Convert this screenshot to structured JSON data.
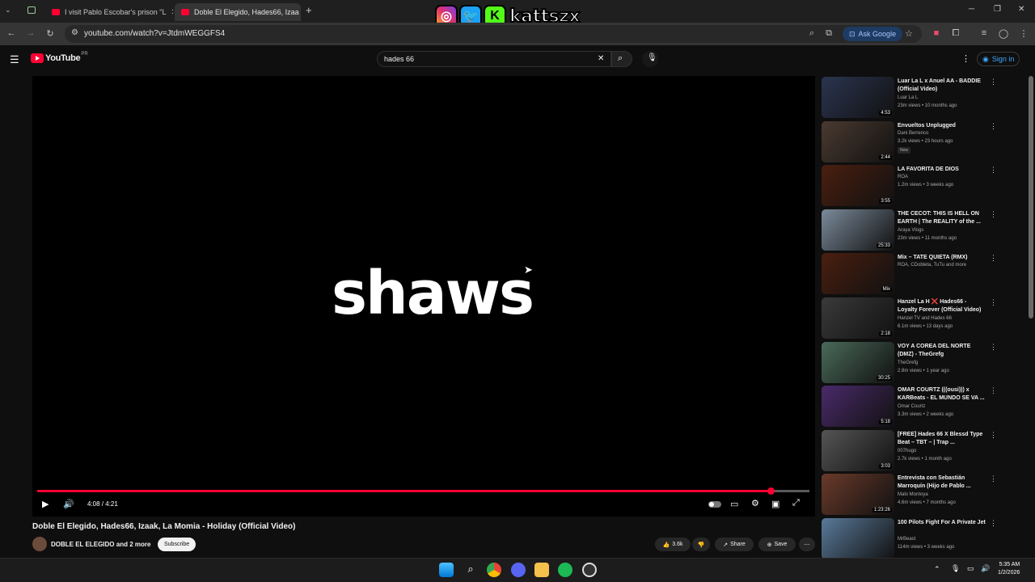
{
  "browser": {
    "tabs": [
      {
        "label": "I visit Pablo Escobar's prison \"L"
      },
      {
        "label": "Doble El Elegido, Hades66, Izaa"
      }
    ],
    "url": "youtube.com/watch?v=JtdmWEGGFS4",
    "ask_google": "Ask Google"
  },
  "overlay": {
    "handle": "kattszx"
  },
  "header": {
    "logo_text": "YouTube",
    "country": "PR",
    "search_value": "hades 66",
    "sign_in": "Sign in"
  },
  "player": {
    "center_text": "shaws",
    "time": "4:08 / 4:21",
    "progress": 0.95
  },
  "video": {
    "title": "Doble El Elegido, Hades66, Izaak, La Momia - Holiday (Official Video)",
    "channel": "DOBLE EL ELEGIDO and 2 more",
    "subscribe": "Subscribe",
    "likes": "3.6k",
    "share": "Share",
    "save": "Save"
  },
  "recommendations": [
    {
      "title": "Luar La L x Anuel AA - BADDIE (Official Video)",
      "channel": "Luar La L",
      "meta": "23m views • 10 months ago",
      "duration": "4:53",
      "color": "#2b3550"
    },
    {
      "title": "Envueltos Unplugged",
      "channel": "Dani Berrenco",
      "meta": "3.2k views • 23 hours ago",
      "duration": "2:44",
      "badge": "New",
      "color": "#4a3a30"
    },
    {
      "title": "LA FAVORITA DE DIOS",
      "channel": "ROA",
      "meta": "1.2m views • 3 weeks ago",
      "duration": "3:55",
      "color": "#4a1f10"
    },
    {
      "title": "THE CECOT: THIS IS HELL ON EARTH | The REALITY of the ...",
      "channel": "Araya Vlogs",
      "meta": "23m views • 11 months ago",
      "duration": "25:33",
      "color": "#7a8a9a"
    },
    {
      "title": "Mix – TATE QUIETA (RMX)",
      "channel": "ROA, CDobleta, TuTu and more",
      "meta": "",
      "duration": "Mix",
      "color": "#4a1f10"
    },
    {
      "title": "Hanzel La H ❌ Hades66 - Loyalty Forever (Official Video)",
      "channel": "Hanzel TV and Hades 66",
      "meta": "6.1m views • 13 days ago",
      "duration": "2:18",
      "color": "#3a3a3a"
    },
    {
      "title": "VOY A COREA DEL NORTE (DMZ) - TheGrefg",
      "channel": "TheGrefg",
      "meta": "2.8m views • 1 year ago",
      "duration": "30:25",
      "color": "#4a6a5a"
    },
    {
      "title": "OMAR COURTZ (((ousi))) x KARBeats - EL MUNDO SE VA ...",
      "channel": "Omar Courtz",
      "meta": "3.3m views • 2 weeks ago",
      "duration": "5:18",
      "color": "#4a2a6a"
    },
    {
      "title": "[FREE] Hades 66 X Blessd Type Beat – TBT – | Trap ...",
      "channel": "007hugo",
      "meta": "2.7k views • 1 month ago",
      "duration": "3:03",
      "color": "#555555"
    },
    {
      "title": "Entrevista con Sebastián Marroquín (Hijo de Pablo ...",
      "channel": "Malo Montoya",
      "meta": "4.6m views • 7 months ago",
      "duration": "1:23:26",
      "color": "#6a3a2a"
    },
    {
      "title": "100 Pilots Fight For A Private Jet",
      "channel": "MrBeast",
      "meta": "114m views • 3 weeks ago",
      "duration": "",
      "color": "#5a7a9a"
    }
  ],
  "taskbar": {
    "time": "5:35 AM",
    "date": "1/2/2026"
  }
}
